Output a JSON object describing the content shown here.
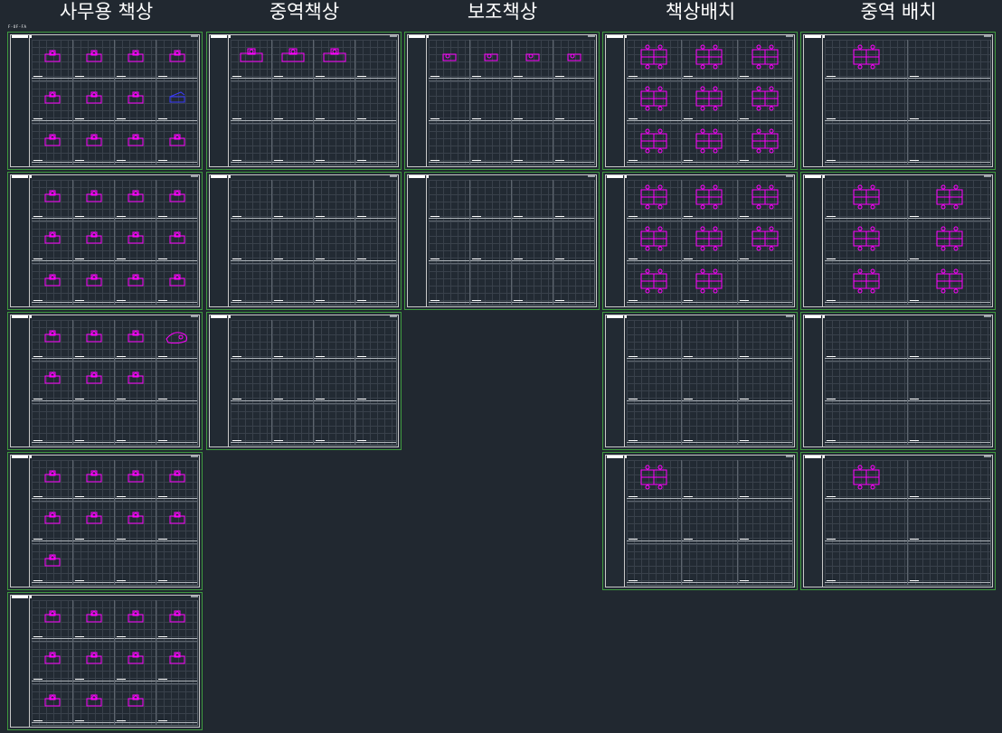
{
  "header": {
    "columns": [
      {
        "title": "사무용 책상"
      },
      {
        "title": "중역책상"
      },
      {
        "title": "보조책상"
      },
      {
        "title": "책상배치"
      },
      {
        "title": "중역 배치"
      }
    ],
    "layout_tab_label": "F-OF-FA"
  },
  "colors": {
    "background": "#212830",
    "sheet_border": "#3f9a3f",
    "drawing_lines": "#c8c8c8",
    "furniture_blocks": "#ff00ff"
  },
  "sheets": [
    {
      "id": "s0",
      "column": 0,
      "row": 0,
      "icons": [
        "desk",
        "desk",
        "desk",
        "desk",
        "desk",
        "desk",
        "desk",
        "desk-b",
        "desk",
        "desk",
        "desk",
        "desk"
      ]
    },
    {
      "id": "s1",
      "column": 0,
      "row": 1,
      "icons": [
        "desk",
        "desk",
        "desk",
        "desk",
        "desk",
        "desk",
        "desk",
        "desk",
        "desk",
        "desk",
        "desk",
        "desk"
      ]
    },
    {
      "id": "s2",
      "column": 0,
      "row": 2,
      "icons": [
        "desk",
        "desk",
        "desk",
        "curve",
        "desk",
        "desk",
        "desk"
      ]
    },
    {
      "id": "s3",
      "column": 0,
      "row": 3,
      "icons": [
        "desk",
        "desk",
        "desk",
        "desk",
        "desk",
        "desk",
        "desk",
        "desk",
        "desk"
      ]
    },
    {
      "id": "s4",
      "column": 0,
      "row": 4,
      "icons": [
        "desk",
        "desk",
        "desk",
        "desk",
        "desk",
        "desk",
        "desk",
        "desk",
        "desk",
        "desk",
        "desk"
      ]
    },
    {
      "id": "s5",
      "column": 1,
      "row": 0,
      "icons": [
        "exec",
        "exec",
        "exec"
      ]
    },
    {
      "id": "s6",
      "column": 1,
      "row": 1,
      "icons": []
    },
    {
      "id": "s7",
      "column": 1,
      "row": 2,
      "icons": []
    },
    {
      "id": "s8",
      "column": 2,
      "row": 0,
      "icons": [
        "aux",
        "aux",
        "aux",
        "aux"
      ]
    },
    {
      "id": "s9",
      "column": 2,
      "row": 1,
      "icons": []
    },
    {
      "id": "s10",
      "column": 3,
      "row": 0,
      "icons": [
        "cluster",
        "cluster",
        "cluster",
        "cluster",
        "cluster",
        "cluster",
        "cluster",
        "cluster",
        "cluster"
      ]
    },
    {
      "id": "s11",
      "column": 3,
      "row": 1,
      "icons": [
        "cluster",
        "cluster",
        "cluster",
        "cluster",
        "cluster",
        "cluster",
        "cluster",
        "cluster"
      ]
    },
    {
      "id": "s12",
      "column": 3,
      "row": 2,
      "icons": []
    },
    {
      "id": "s13",
      "column": 3,
      "row": 3,
      "icons": [
        "cluster"
      ]
    },
    {
      "id": "s14",
      "column": 4,
      "row": 0,
      "icons": [
        "cluster"
      ]
    },
    {
      "id": "s15",
      "column": 4,
      "row": 1,
      "icons": [
        "cluster",
        "cluster",
        "cluster",
        "cluster",
        "cluster",
        "cluster"
      ]
    },
    {
      "id": "s16",
      "column": 4,
      "row": 2,
      "icons": []
    },
    {
      "id": "s17",
      "column": 4,
      "row": 3,
      "icons": [
        "cluster"
      ]
    }
  ]
}
